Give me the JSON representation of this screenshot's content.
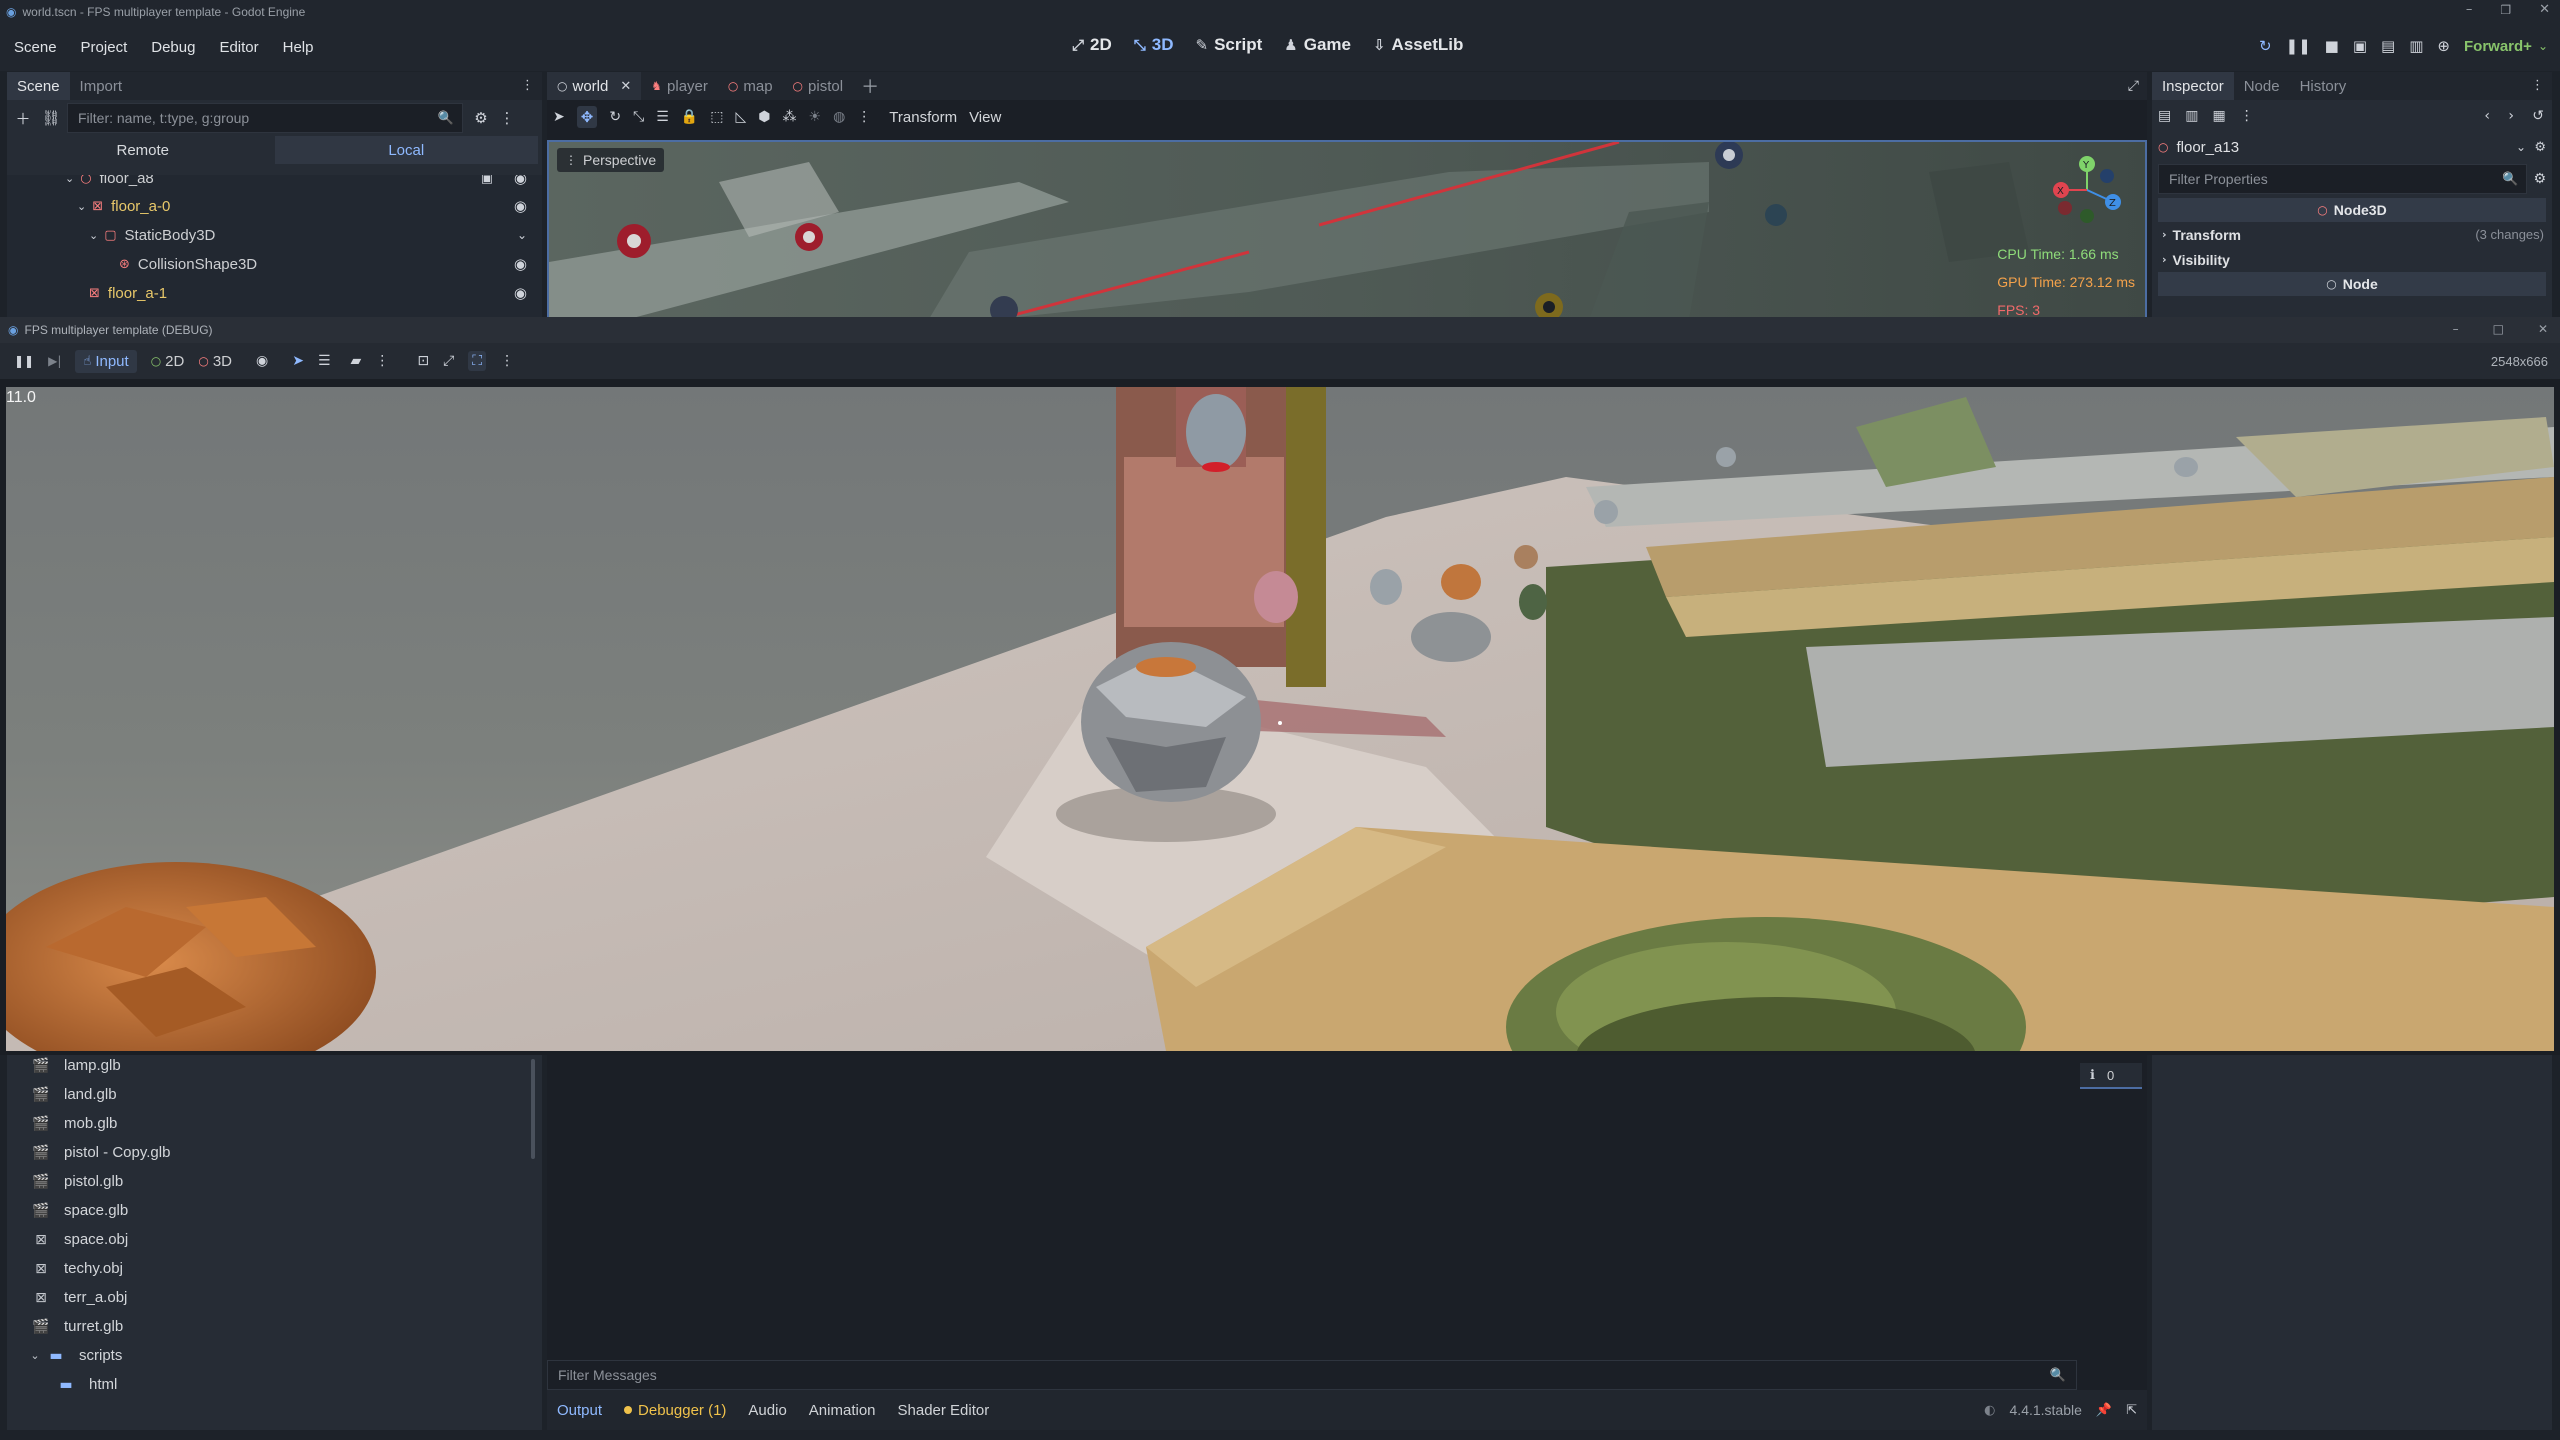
{
  "editor_title": "world.tscn - FPS multiplayer template - Godot Engine",
  "menu": [
    "Scene",
    "Project",
    "Debug",
    "Editor",
    "Help"
  ],
  "workspaces": [
    {
      "label": "2D",
      "icon": "2d-icon"
    },
    {
      "label": "3D",
      "icon": "3d-icon"
    },
    {
      "label": "Script",
      "icon": "script-icon"
    },
    {
      "label": "Game",
      "icon": "game-icon"
    },
    {
      "label": "AssetLib",
      "icon": "assetlib-icon"
    }
  ],
  "renderer": "Forward+",
  "scene_dock": {
    "tabs": [
      "Scene",
      "Import"
    ],
    "filter_placeholder": "Filter: name, t:type, g:group",
    "remote_local": [
      "Remote",
      "Local"
    ],
    "tree": [
      {
        "label": "floor_a8",
        "depth": 0
      },
      {
        "label": "floor_a-0",
        "depth": 1
      },
      {
        "label": "StaticBody3D",
        "depth": 2
      },
      {
        "label": "CollisionShape3D",
        "depth": 3
      },
      {
        "label": "floor_a-1",
        "depth": 1
      }
    ]
  },
  "scene_tabs": [
    "world",
    "player",
    "map",
    "pistol"
  ],
  "viewport_toolbar": {
    "transform": "Transform",
    "view": "View",
    "perspective": "Perspective"
  },
  "stats": {
    "cpu": "CPU Time: 1.66 ms",
    "gpu": "GPU Time: 273.12 ms",
    "fps": "FPS: 3"
  },
  "inspector": {
    "tabs": [
      "Inspector",
      "Node",
      "History"
    ],
    "object": "floor_a13",
    "filter_placeholder": "Filter Properties",
    "section_node3d": "Node3D",
    "transform": "Transform",
    "transform_changes": "(3 changes)",
    "visibility": "Visibility",
    "section_node": "Node"
  },
  "game_window": {
    "title": "FPS multiplayer template (DEBUG)",
    "resolution": "2548x666",
    "input_label": "Input",
    "mode_2d": "2D",
    "mode_3d": "3D",
    "fps_counter": "11.0"
  },
  "files": [
    {
      "name": "lamp.glb",
      "icon": "scene-file-icon"
    },
    {
      "name": "land.glb",
      "icon": "scene-file-icon"
    },
    {
      "name": "mob.glb",
      "icon": "scene-file-icon"
    },
    {
      "name": "pistol - Copy.glb",
      "icon": "scene-file-icon"
    },
    {
      "name": "pistol.glb",
      "icon": "scene-file-icon"
    },
    {
      "name": "space.glb",
      "icon": "scene-file-icon"
    },
    {
      "name": "space.obj",
      "icon": "mesh-file-icon"
    },
    {
      "name": "techy.obj",
      "icon": "mesh-file-icon"
    },
    {
      "name": "terr_a.obj",
      "icon": "mesh-file-icon"
    },
    {
      "name": "turret.glb",
      "icon": "scene-file-icon"
    },
    {
      "name": "scripts",
      "icon": "folder-icon"
    },
    {
      "name": "html",
      "icon": "folder-icon"
    }
  ],
  "output": {
    "filter_placeholder": "Filter Messages",
    "message_count": "0",
    "bottom_tabs": [
      "Output",
      "Debugger (1)",
      "Audio",
      "Animation",
      "Shader Editor"
    ],
    "version": "4.4.1.stable"
  },
  "colors": {
    "accent": "#8fb9ff",
    "node3d_red": "#fc7f7f",
    "panel": "#262c35"
  }
}
